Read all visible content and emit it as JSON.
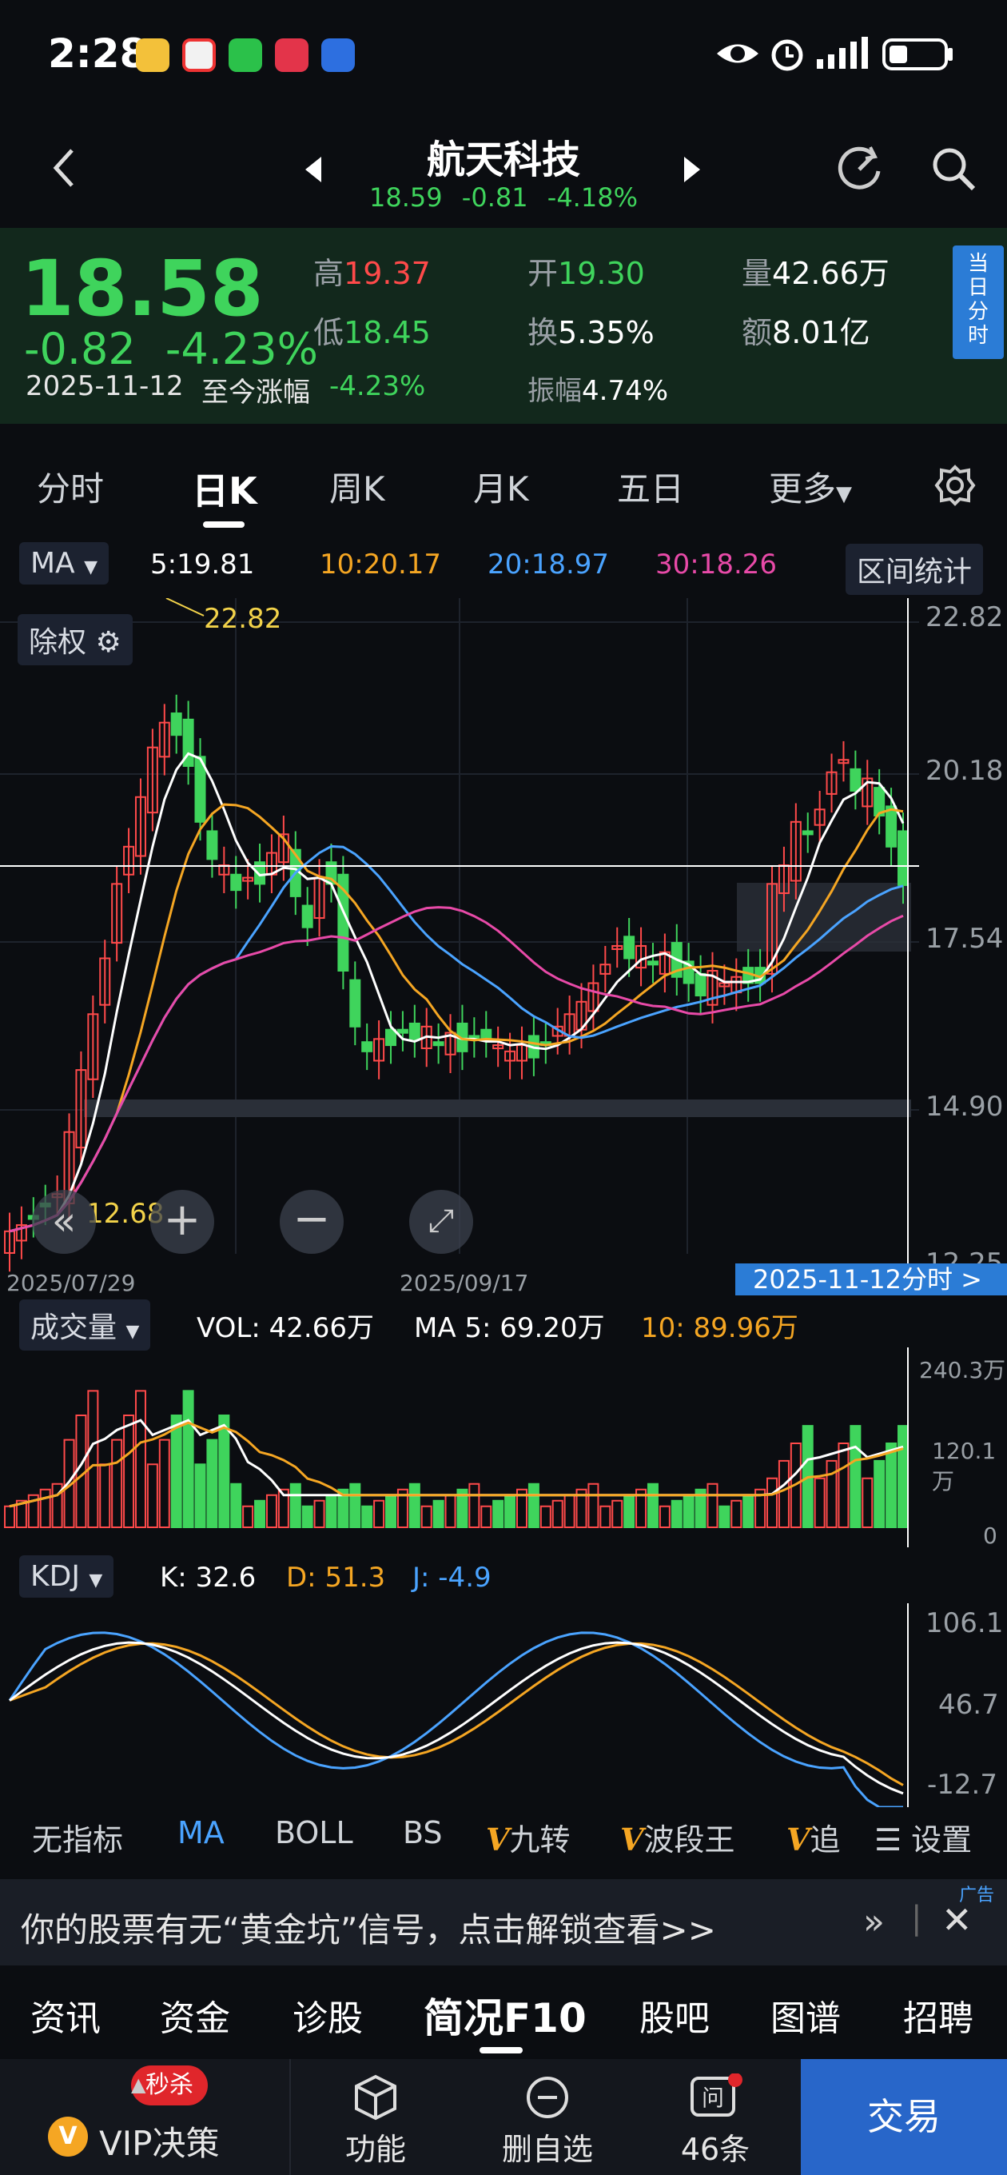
{
  "status_bar": {
    "time": "2:28"
  },
  "header": {
    "stock_name": "航天科技",
    "price": "18.59",
    "change": "-0.81",
    "change_pct": "-4.18%"
  },
  "quote": {
    "price": "18.58",
    "change": "-0.82",
    "change_pct": "-4.23%",
    "date": "2025-11-12",
    "since_label": "至今涨幅",
    "since_value": "-4.23%",
    "high_label": "高",
    "high": "19.37",
    "low_label": "低",
    "low": "18.45",
    "open_label": "开",
    "open": "19.30",
    "turnover_label": "换",
    "turnover": "5.35%",
    "amplitude_label": "振幅",
    "amplitude": "4.74%",
    "volume_label": "量",
    "volume": "42.66万",
    "amount_label": "额",
    "amount": "8.01亿",
    "today_minute_button": "当日分时"
  },
  "tabs": [
    "分时",
    "日K",
    "周K",
    "月K",
    "五日",
    "更多"
  ],
  "ma_row": {
    "selector": "MA",
    "ma5": "5:19.81",
    "ma10": "10:20.17",
    "ma20": "20:18.97",
    "ma30": "30:18.26",
    "range_stats": "区间统计"
  },
  "kchart": {
    "adjust_label": "除权",
    "y_labels": [
      "22.82",
      "20.18",
      "17.54",
      "14.90",
      "12.25"
    ],
    "high_marker": "22.82",
    "low_marker": "12.68",
    "x_labels": [
      "2025/07/29",
      "2025/09/17"
    ],
    "date_bar": "2025-11-12分时  >"
  },
  "volume": {
    "selector": "成交量",
    "vol": "VOL:  42.66万",
    "ma5": "MA 5:  69.20万",
    "ma10": "10:  89.96万",
    "y_labels": [
      "240.3万",
      "120.1万",
      "0"
    ]
  },
  "kdj": {
    "selector": "KDJ",
    "k": "K:  32.6",
    "d": "D:  51.3",
    "j": "J:  -4.9",
    "y_labels": [
      "106.1",
      "46.7",
      "-12.7"
    ]
  },
  "indicators": [
    "无指标",
    "MA",
    "BOLL",
    "BS",
    "九转",
    "波段王",
    "追"
  ],
  "indicator_settings": "设置",
  "ad": {
    "text": "你的股票有无“黄金坑”信号，点击解锁查看>>",
    "tag": "广告"
  },
  "subtabs": [
    "资讯",
    "资金",
    "诊股",
    "简况F10",
    "股吧",
    "图谱",
    "招聘"
  ],
  "bottom": {
    "flash_badge": "秒杀",
    "vip": "VIP决策",
    "func": "功能",
    "remove": "删自选",
    "ask": "46条",
    "trade": "交易"
  },
  "colors": {
    "up": "#ff4a4a",
    "down": "#3fd45c",
    "ma5": "#ffffff",
    "ma10": "#f5a623",
    "ma20": "#4aa3ff",
    "ma30": "#e84aa8",
    "accent": "#2b7cd6"
  }
}
